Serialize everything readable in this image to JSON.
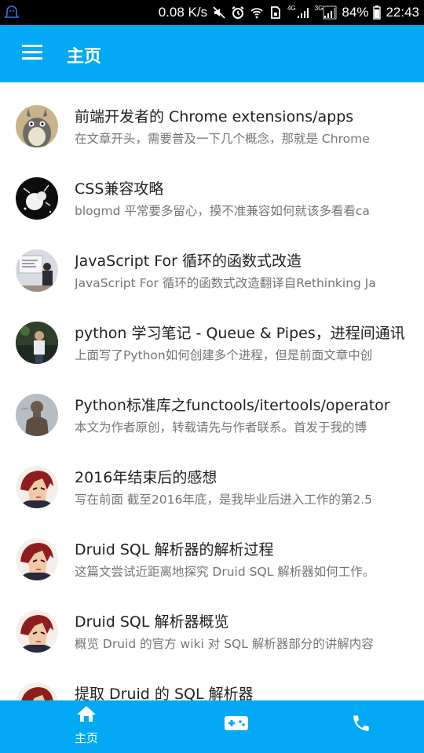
{
  "status_bar": {
    "speed": "0.08 K/s",
    "net_4g": "4G",
    "net_3g": "3G",
    "battery": "84%",
    "time": "22:43"
  },
  "app_bar": {
    "title": "主页"
  },
  "articles": [
    {
      "title": "前端开发者的 Chrome extensions/apps",
      "desc": "在文章开头，需要普及一下几个概念，那就是 Chrome",
      "avatar": "totoro"
    },
    {
      "title": "CSS兼容攻略",
      "desc": "blogmd 平常要多留心，摸不准兼容如何就该多看看ca",
      "avatar": "dark-cartoon"
    },
    {
      "title": "JavaScript For 循环的函数式改造",
      "desc": "JavaScript For 循环的函数式改造翻译自Rethinking Ja",
      "avatar": "presenter"
    },
    {
      "title": "python 学习笔记 - Queue & Pipes，进程间通讯",
      "desc": "上面写了Python如何创建多个进程，但是前面文章中创",
      "avatar": "person-photo"
    },
    {
      "title": "Python标准库之functools/itertools/operator",
      "desc": "本文为作者原创，转载请先与作者联系。首发于我的博",
      "avatar": "statue"
    },
    {
      "title": "2016年结束后的感想",
      "desc": "写在前面 截至2016年底，是我毕业后进入工作的第2.5",
      "avatar": "red-hair-anime"
    },
    {
      "title": "Druid SQL 解析器的解析过程",
      "desc": "这篇文尝试近距离地探究 Druid SQL 解析器如何工作。",
      "avatar": "red-hair-anime"
    },
    {
      "title": "Druid SQL 解析器概览",
      "desc": "概览 Druid 的官方 wiki 对 SQL 解析器部分的讲解内容",
      "avatar": "red-hair-anime"
    },
    {
      "title": "提取 Druid 的 SQL 解析器",
      "desc": "",
      "avatar": "red-hair-anime"
    }
  ],
  "bottom_nav": {
    "tabs": [
      {
        "label": "主页",
        "icon": "home-icon",
        "active": true
      },
      {
        "label": "",
        "icon": "gamepad-icon",
        "active": false
      },
      {
        "label": "",
        "icon": "phone-icon",
        "active": false
      }
    ]
  },
  "colors": {
    "primary": "#03a9f4",
    "title_text": "#212121",
    "desc_text": "#757575"
  }
}
